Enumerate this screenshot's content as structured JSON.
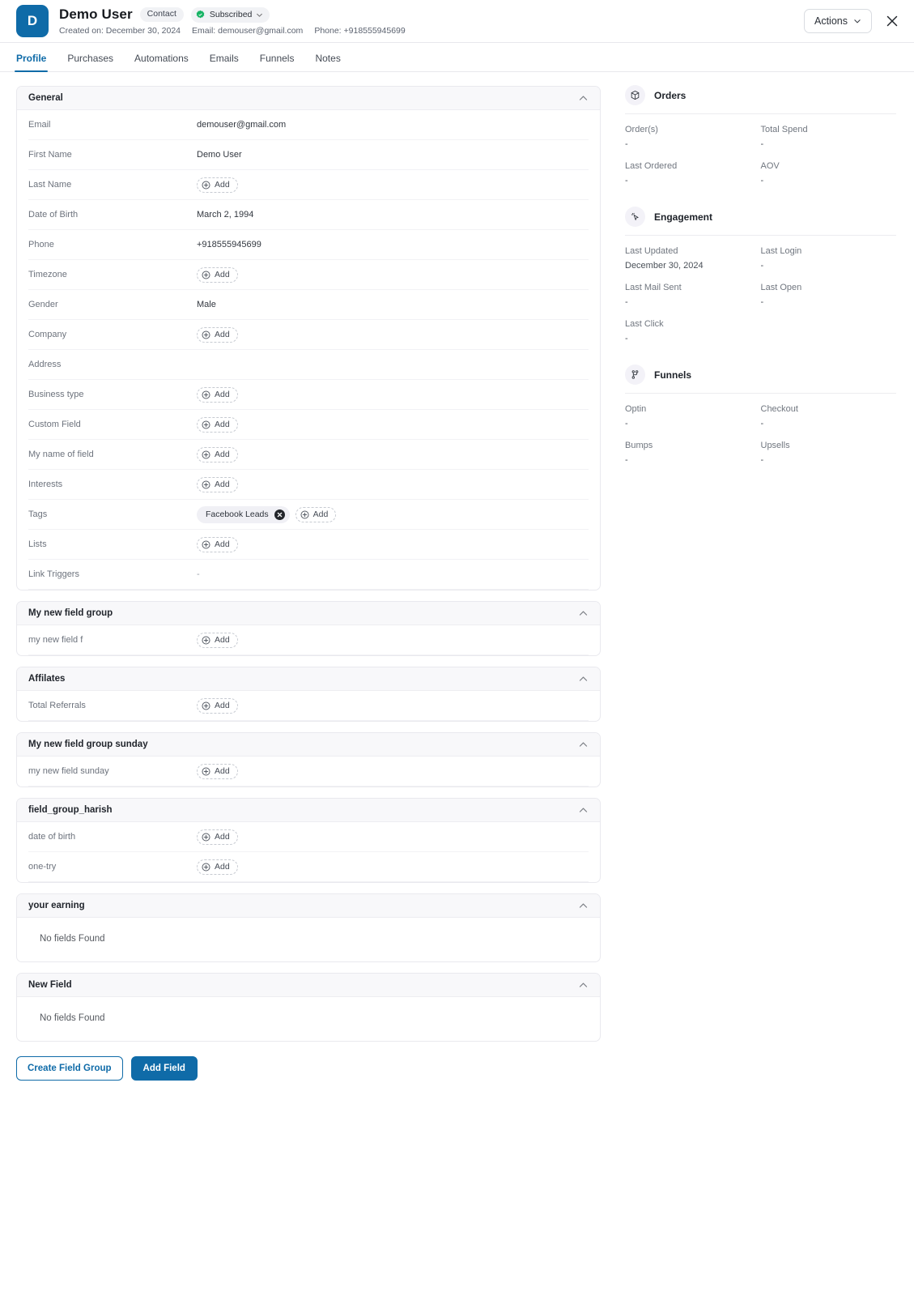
{
  "header": {
    "avatar_initial": "D",
    "name": "Demo User",
    "chip_contact": "Contact",
    "chip_subscribed": "Subscribed",
    "created_label": "Created on: December 30, 2024",
    "email_label": "Email: demouser@gmail.com",
    "phone_label": "Phone: +918555945699",
    "actions_label": "Actions",
    "accent_color": "#0f6ba8",
    "subscribed_color": "#16b364"
  },
  "tabs": [
    {
      "label": "Profile",
      "active": true
    },
    {
      "label": "Purchases",
      "active": false
    },
    {
      "label": "Automations",
      "active": false
    },
    {
      "label": "Emails",
      "active": false
    },
    {
      "label": "Funnels",
      "active": false
    },
    {
      "label": "Notes",
      "active": false
    }
  ],
  "add_label": "Add",
  "empty_text": "No fields Found",
  "groups": [
    {
      "title": "General",
      "fields": [
        {
          "label": "Email",
          "value": "demouser@gmail.com",
          "type": "text"
        },
        {
          "label": "First Name",
          "value": "Demo User",
          "type": "text"
        },
        {
          "label": "Last Name",
          "value": "",
          "type": "add"
        },
        {
          "label": "Date of Birth",
          "value": "March 2, 1994",
          "type": "text"
        },
        {
          "label": "Phone",
          "value": "+918555945699",
          "type": "text"
        },
        {
          "label": "Timezone",
          "value": "",
          "type": "add"
        },
        {
          "label": "Gender",
          "value": "Male",
          "type": "text"
        },
        {
          "label": "Company",
          "value": "",
          "type": "add"
        },
        {
          "label": "Address",
          "value": "",
          "type": "blank"
        },
        {
          "label": "Business type",
          "value": "",
          "type": "add"
        },
        {
          "label": "Custom Field",
          "value": "",
          "type": "add"
        },
        {
          "label": "My name of field",
          "value": "",
          "type": "add"
        },
        {
          "label": "Interests",
          "value": "",
          "type": "add"
        },
        {
          "label": "Tags",
          "value": "",
          "type": "tags",
          "tags": [
            "Facebook Leads"
          ]
        },
        {
          "label": "Lists",
          "value": "",
          "type": "add"
        },
        {
          "label": "Link Triggers",
          "value": "-",
          "type": "dash"
        }
      ]
    },
    {
      "title": "My new field group",
      "fields": [
        {
          "label": "my new field f",
          "value": "",
          "type": "add"
        }
      ]
    },
    {
      "title": "Affilates",
      "fields": [
        {
          "label": "Total Referrals",
          "value": "",
          "type": "add"
        }
      ]
    },
    {
      "title": "My new field group sunday",
      "fields": [
        {
          "label": "my new field sunday",
          "value": "",
          "type": "add"
        }
      ]
    },
    {
      "title": "field_group_harish",
      "fields": [
        {
          "label": "date of birth",
          "value": "",
          "type": "add"
        },
        {
          "label": "one-try",
          "value": "",
          "type": "add"
        }
      ]
    },
    {
      "title": "your earning",
      "fields": [],
      "empty": "No fields Found"
    },
    {
      "title": "New Field",
      "fields": [],
      "empty": "No fields Found"
    }
  ],
  "footer": {
    "create_field_group": "Create Field Group",
    "add_field": "Add Field"
  },
  "panels": [
    {
      "title": "Orders",
      "icon": "box-icon",
      "metrics": [
        {
          "key": "Order(s)",
          "value": "-"
        },
        {
          "key": "Total Spend",
          "value": "-"
        },
        {
          "key": "Last Ordered",
          "value": "-"
        },
        {
          "key": "AOV",
          "value": "-"
        }
      ]
    },
    {
      "title": "Engagement",
      "icon": "cursor-click-icon",
      "metrics": [
        {
          "key": "Last Updated",
          "value": "December 30, 2024"
        },
        {
          "key": "Last Login",
          "value": "-"
        },
        {
          "key": "Last Mail Sent",
          "value": "-"
        },
        {
          "key": "Last Open",
          "value": "-"
        },
        {
          "key": "Last Click",
          "value": "-"
        }
      ]
    },
    {
      "title": "Funnels",
      "icon": "funnel-network-icon",
      "metrics": [
        {
          "key": "Optin",
          "value": "-"
        },
        {
          "key": "Checkout",
          "value": "-"
        },
        {
          "key": "Bumps",
          "value": "-"
        },
        {
          "key": "Upsells",
          "value": "-"
        }
      ]
    }
  ]
}
